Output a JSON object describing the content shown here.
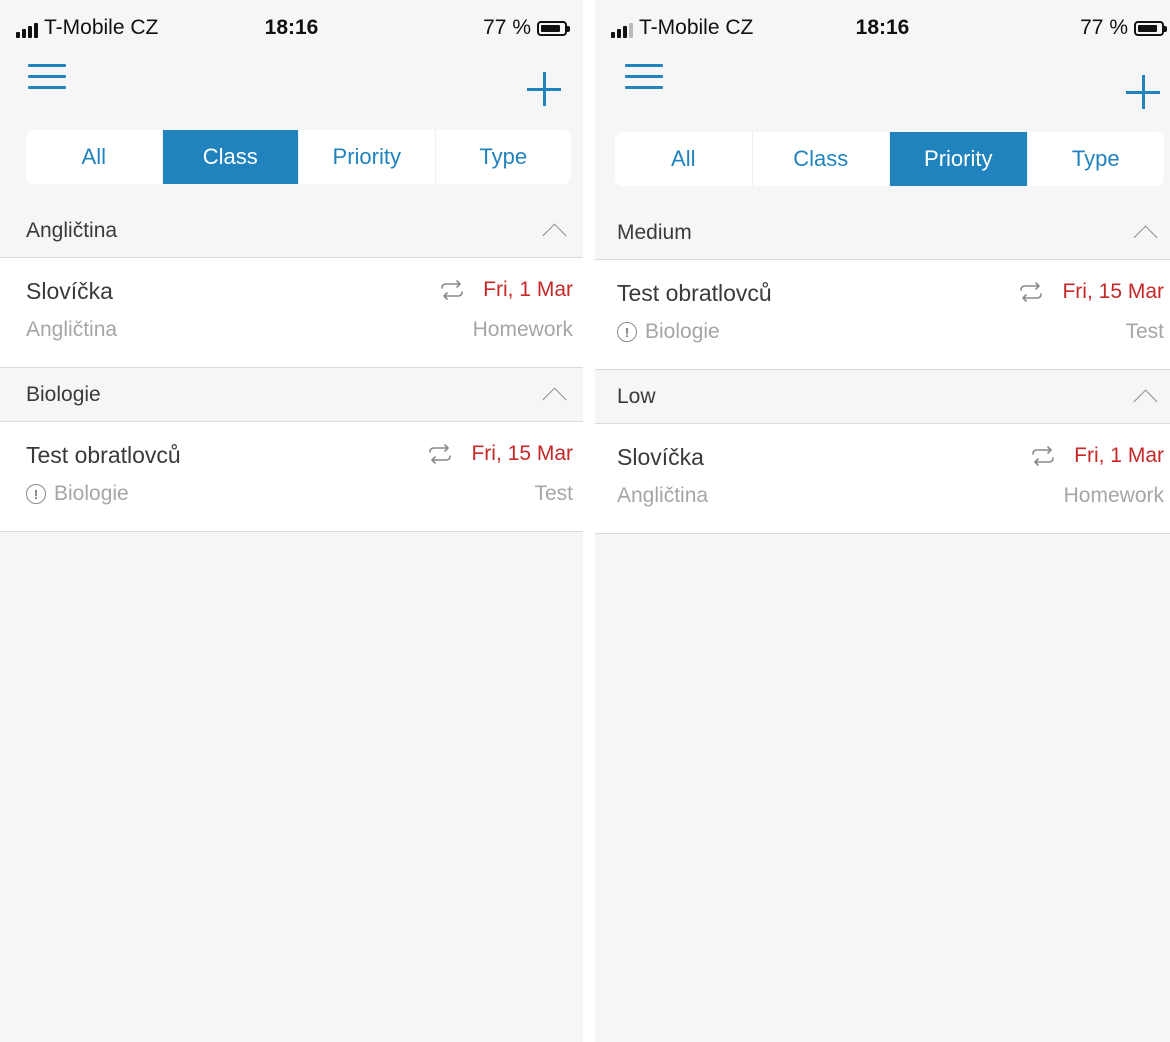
{
  "screens": [
    {
      "status": {
        "carrier": "T-Mobile CZ",
        "time": "18:16",
        "battery": "77 %"
      },
      "tabs": [
        {
          "label": "All",
          "active": false
        },
        {
          "label": "Class",
          "active": true
        },
        {
          "label": "Priority",
          "active": false
        },
        {
          "label": "Type",
          "active": false
        }
      ],
      "sections": [
        {
          "title": "Angličtina",
          "tasks": [
            {
              "title": "Slovíčka",
              "subtitle": "Angličtina",
              "date": "Fri, 1 Mar",
              "type": "Homework",
              "important": false
            }
          ]
        },
        {
          "title": "Biologie",
          "tasks": [
            {
              "title": "Test obratlovců",
              "subtitle": "Biologie",
              "date": "Fri, 15 Mar",
              "type": "Test",
              "important": true
            }
          ]
        }
      ]
    },
    {
      "status": {
        "carrier": "T-Mobile CZ",
        "time": "18:16",
        "battery": "77 %"
      },
      "tabs": [
        {
          "label": "All",
          "active": false
        },
        {
          "label": "Class",
          "active": false
        },
        {
          "label": "Priority",
          "active": true
        },
        {
          "label": "Type",
          "active": false
        }
      ],
      "sections": [
        {
          "title": "Medium",
          "tasks": [
            {
              "title": "Test obratlovců",
              "subtitle": "Biologie",
              "date": "Fri, 15 Mar",
              "type": "Test",
              "important": true
            }
          ]
        },
        {
          "title": "Low",
          "tasks": [
            {
              "title": "Slovíčka",
              "subtitle": "Angličtina",
              "date": "Fri, 1 Mar",
              "type": "Homework",
              "important": false
            }
          ]
        }
      ]
    }
  ],
  "colors": {
    "accent": "#2083bd",
    "due": "#c62828",
    "muted": "#a6a6a6",
    "background": "#f6f6f6"
  },
  "icons": {
    "menu": "hamburger-icon",
    "add": "plus-icon",
    "repeat": "repeat-icon",
    "important": "exclamation-circle-icon",
    "collapse": "chevron-up-icon"
  }
}
